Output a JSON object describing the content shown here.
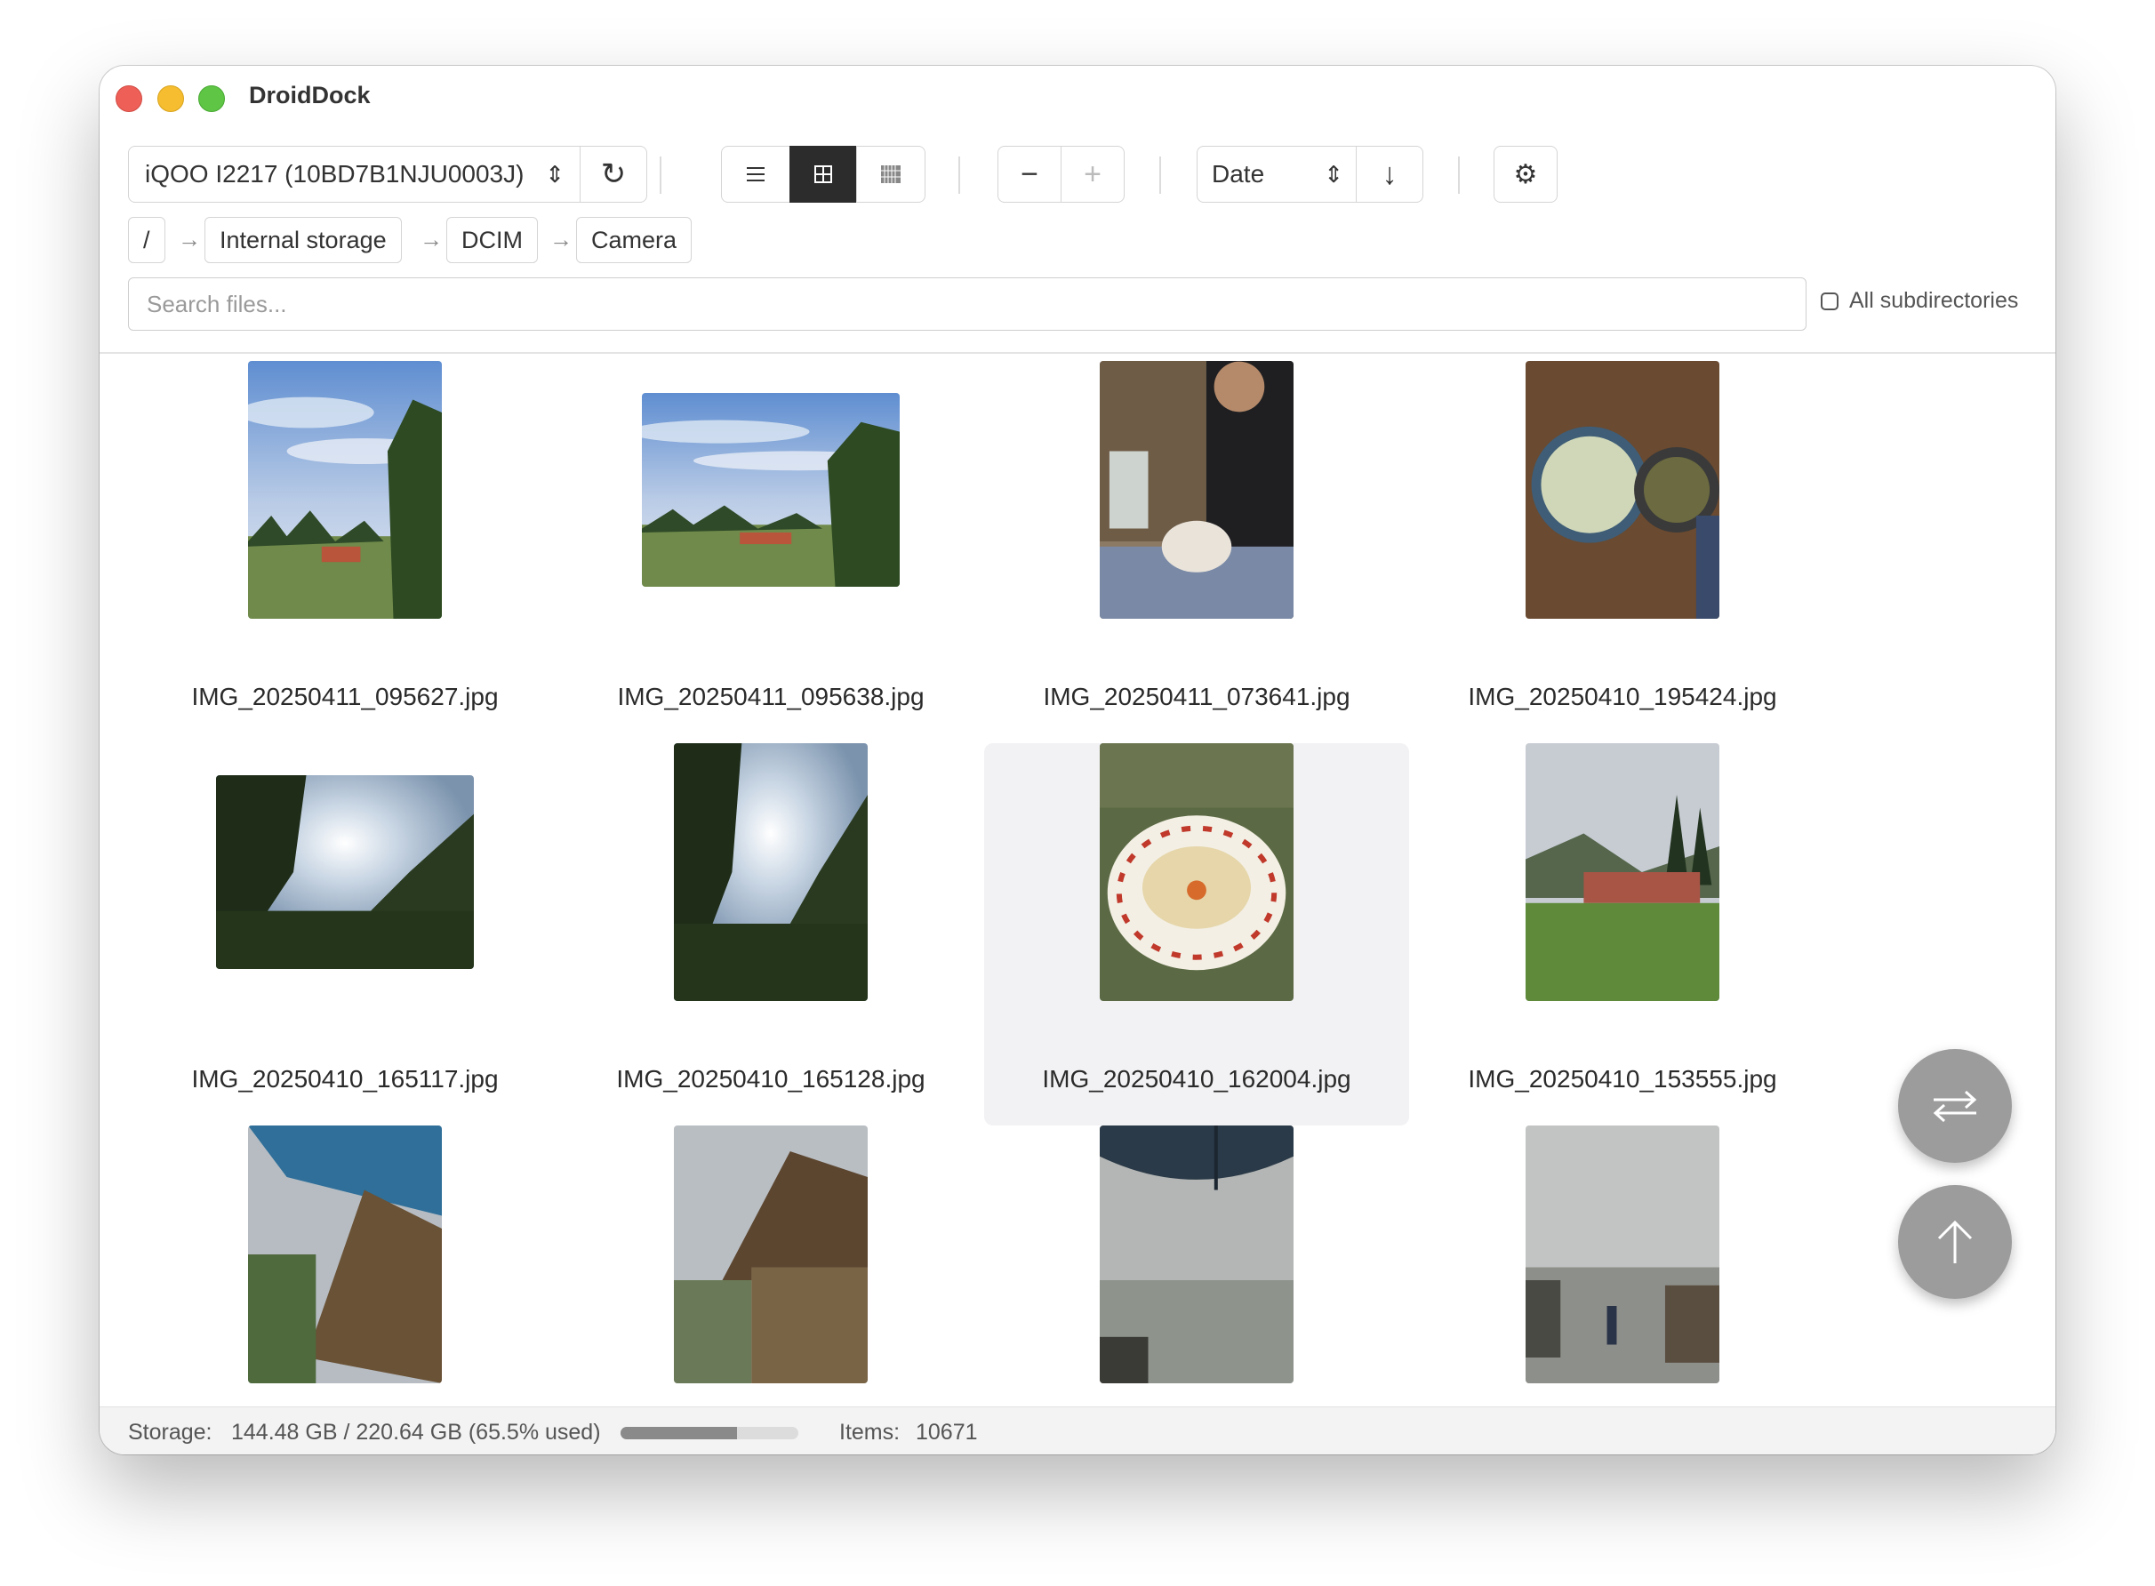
{
  "app": {
    "title": "DroidDock"
  },
  "toolbar": {
    "device": "iQOO I2217 (10BD7B1NJU0003J)",
    "sort_field": "Date",
    "view_mode": "grid"
  },
  "breadcrumb": [
    "/",
    "Internal storage",
    "DCIM",
    "Camera"
  ],
  "search": {
    "placeholder": "Search files...",
    "value": ""
  },
  "subdirectories": {
    "label": "All subdirectories",
    "checked": false
  },
  "files": [
    {
      "name": "IMG_20250411_095627.jpg",
      "orientation": "portrait",
      "scene": "sky-house"
    },
    {
      "name": "IMG_20250411_095638.jpg",
      "orientation": "landscape",
      "scene": "sky-house"
    },
    {
      "name": "IMG_20250411_073641.jpg",
      "orientation": "portrait",
      "scene": "person-cat"
    },
    {
      "name": "IMG_20250410_195424.jpg",
      "orientation": "portrait",
      "scene": "food-bowls"
    },
    {
      "name": "IMG_20250410_165117.jpg",
      "orientation": "landscape",
      "scene": "forest-sun"
    },
    {
      "name": "IMG_20250410_165128.jpg",
      "orientation": "portrait",
      "scene": "forest-sun"
    },
    {
      "name": "IMG_20250410_162004.jpg",
      "orientation": "portrait",
      "scene": "momo-plate",
      "selected": true
    },
    {
      "name": "IMG_20250410_153555.jpg",
      "orientation": "portrait",
      "scene": "lodge"
    },
    {
      "name": "",
      "orientation": "portrait",
      "scene": "hut-umbrella"
    },
    {
      "name": "",
      "orientation": "portrait",
      "scene": "hut"
    },
    {
      "name": "",
      "orientation": "portrait",
      "scene": "fog-umbrella"
    },
    {
      "name": "",
      "orientation": "portrait",
      "scene": "fog-road"
    }
  ],
  "status": {
    "storage_label": "Storage:",
    "storage_value": "144.48 GB / 220.64 GB (65.5% used)",
    "storage_fraction": 0.655,
    "items_label": "Items:",
    "items_value": "10671"
  },
  "colors": {
    "accent": "#2c2c2c",
    "fab": "#9c9c9c",
    "selection": "#f2f2f4"
  },
  "icons": [
    "refresh-icon",
    "list-view-icon",
    "grid-view-icon",
    "gallery-view-icon",
    "zoom-out-icon",
    "zoom-in-icon",
    "sort-direction-icon",
    "settings-icon",
    "swap-icon",
    "scroll-top-icon"
  ]
}
